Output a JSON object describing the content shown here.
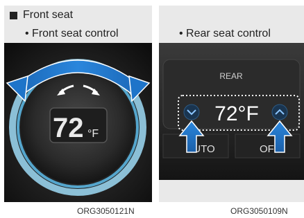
{
  "section": {
    "bullet_label": "Front seat"
  },
  "left_panel": {
    "subtitle": "• Front seat control",
    "temperature": "72",
    "unit": "°F",
    "caption": "ORG3050121N",
    "icons": [
      "rotate-arrow-icon",
      "curved-arrow-left-icon",
      "curved-arrow-right-icon"
    ]
  },
  "right_panel": {
    "subtitle": "• Rear seat control",
    "header_label": "REAR",
    "temperature": "72°F",
    "left_button": "AUTO",
    "right_button": "OFF",
    "caption": "ORG3050109N",
    "icons": [
      "chevron-down-icon",
      "chevron-up-icon",
      "arrow-up-icon"
    ]
  },
  "colors": {
    "accent_blue": "#1e74c9",
    "ring_blue": "#7fd0f5",
    "panel_bg": "#e9e9e9"
  }
}
